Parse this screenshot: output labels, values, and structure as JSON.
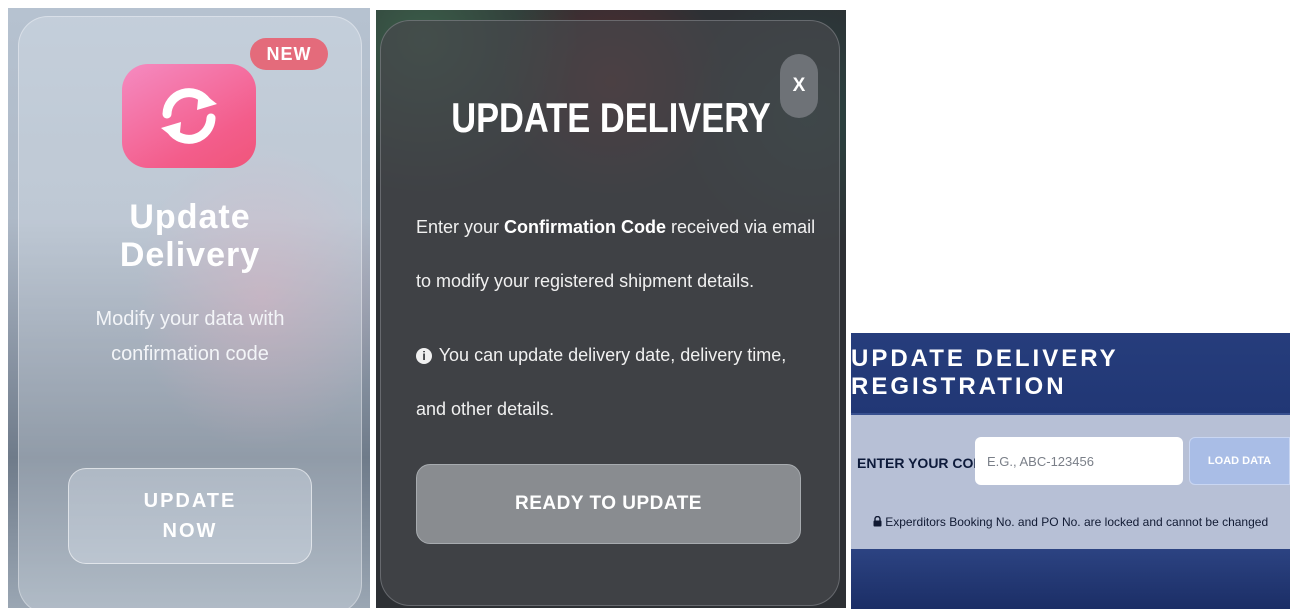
{
  "panel1": {
    "badge": "NEW",
    "icon": "refresh-icon",
    "title_line1": "Update",
    "title_line2": "Delivery",
    "subtitle": "Modify your data with confirmation code",
    "button_line1": "UPDATE",
    "button_line2": "NOW"
  },
  "panel2": {
    "close_label": "X",
    "title": "UPDATE DELIVERY",
    "body_before": "Enter your ",
    "body_bold": "Confirmation Code",
    "body_after": " received via email to modify your registered shipment details.",
    "info_icon": "i",
    "info_text": "You can update delivery date, delivery time, and other details.",
    "button_label": "READY TO UPDATE"
  },
  "panel3": {
    "title": "UPDATE DELIVERY REGISTRATION",
    "code_label": "ENTER YOUR CODE:",
    "code_placeholder": "E.G., ABC-123456",
    "load_button": "LOAD DATA",
    "lock_icon": "lock-icon",
    "note": "Experditors Booking No. and PO No. are locked and cannot be changed"
  }
}
